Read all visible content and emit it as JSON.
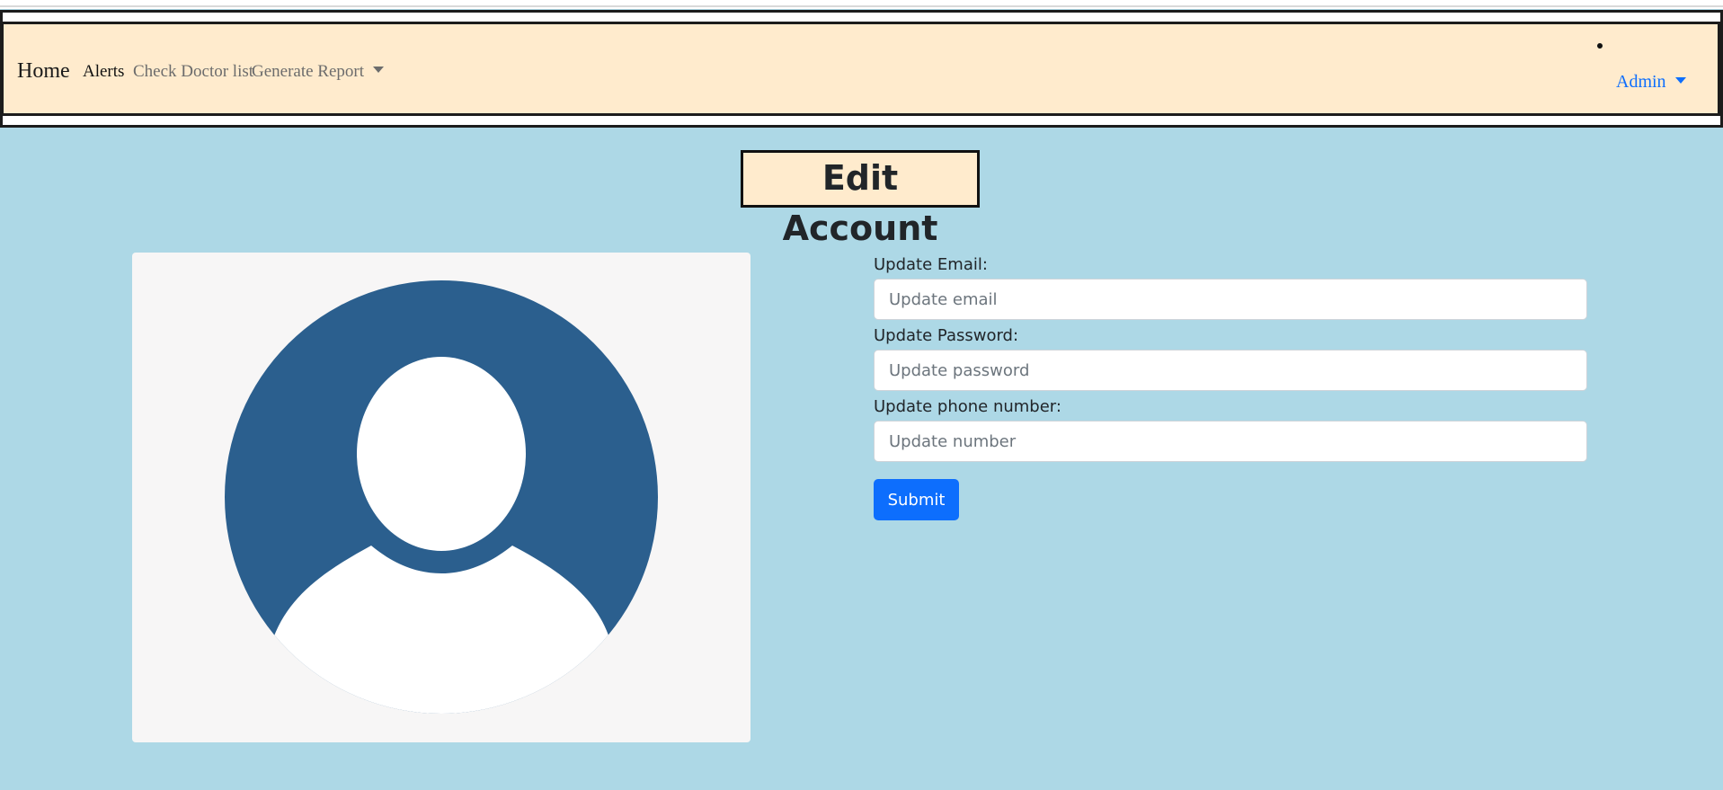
{
  "navbar": {
    "brand": "Home",
    "links": [
      {
        "label": "Alerts"
      },
      {
        "label": "Check Doctor list"
      },
      {
        "label": "Generate Report"
      }
    ],
    "user_menu": "Admin"
  },
  "page_title": "Edit Account",
  "form": {
    "email_label": "Update Email:",
    "email_placeholder": "Update email",
    "password_label": "Update Password:",
    "password_placeholder": "Update password",
    "phone_label": "Update phone number:",
    "phone_placeholder": "Update number",
    "submit_label": "Submit"
  },
  "avatar": {
    "icon": "user-avatar-icon"
  },
  "colors": {
    "page_background": "#add8e6",
    "navbar_background": "#ffebcd",
    "title_background": "#ffebcd",
    "avatar_circle": "#2b5f8e",
    "avatar_card": "#f7f6f6",
    "primary_button": "#0d6efd",
    "admin_link": "#0d6efd"
  }
}
